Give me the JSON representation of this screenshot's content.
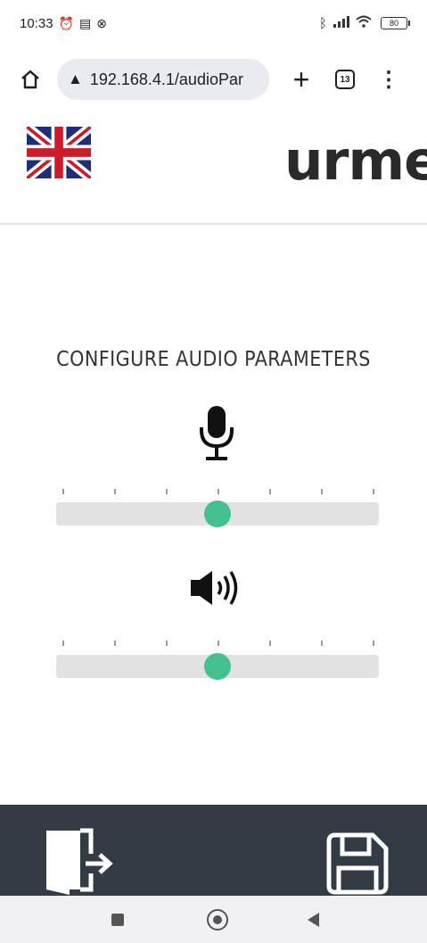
{
  "status_bar": {
    "time": "10:33",
    "icons": [
      "alarm-icon",
      "calendar-icon",
      "xbox-icon"
    ],
    "right_icons": [
      "bluetooth-icon",
      "signal-icon",
      "wifi-icon"
    ],
    "battery": "80"
  },
  "browser": {
    "url": "192.168.4.1/audioPar",
    "security_icon": "warning-icon",
    "tab_count": "13"
  },
  "header": {
    "language_flag": "uk-flag",
    "brand": "urmet"
  },
  "main": {
    "title": "CONFIGURE AUDIO PARAMETERS",
    "sliders": [
      {
        "name": "microphone",
        "icon": "microphone-icon",
        "value": 0.5,
        "ticks": 7
      },
      {
        "name": "speaker",
        "icon": "speaker-icon",
        "value": 0.5,
        "ticks": 7
      }
    ],
    "accent_color": "#43c18f"
  },
  "footer": {
    "left_icon": "logout-icon",
    "right_icon": "save-icon",
    "background": "#333b45"
  },
  "system_nav": {
    "items": [
      "recents-icon",
      "home-icon",
      "back-icon"
    ]
  }
}
